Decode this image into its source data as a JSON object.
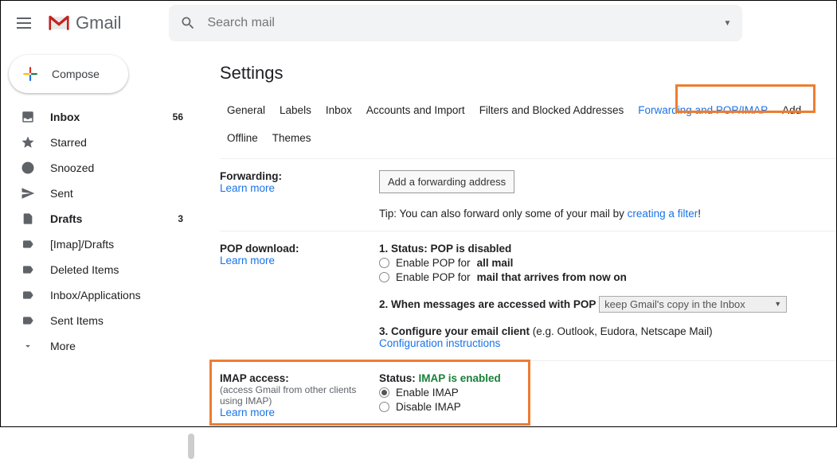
{
  "header": {
    "logo_text": "Gmail",
    "search_placeholder": "Search mail"
  },
  "compose": {
    "label": "Compose"
  },
  "sidebar": {
    "items": [
      {
        "icon": "inbox",
        "label": "Inbox",
        "count": "56",
        "bold": true
      },
      {
        "icon": "star",
        "label": "Starred"
      },
      {
        "icon": "clock",
        "label": "Snoozed"
      },
      {
        "icon": "send",
        "label": "Sent"
      },
      {
        "icon": "file",
        "label": "Drafts",
        "count": "3",
        "bold": true
      },
      {
        "icon": "label",
        "label": "[Imap]/Drafts"
      },
      {
        "icon": "label",
        "label": "Deleted Items"
      },
      {
        "icon": "label",
        "label": "Inbox/Applications"
      },
      {
        "icon": "label",
        "label": "Sent Items"
      },
      {
        "icon": "more",
        "label": "More"
      }
    ]
  },
  "settings": {
    "title": "Settings",
    "tabs": [
      "General",
      "Labels",
      "Inbox",
      "Accounts and Import",
      "Filters and Blocked Addresses",
      "Forwarding and POP/IMAP",
      "Add"
    ],
    "tabs_row2": [
      "Offline",
      "Themes"
    ],
    "active_tab_index": 5,
    "forwarding": {
      "title": "Forwarding:",
      "learn_more": "Learn more",
      "button": "Add a forwarding address",
      "tip_prefix": "Tip: You can also forward only some of your mail by ",
      "tip_link": "creating a filter",
      "tip_suffix": "!"
    },
    "pop": {
      "title": "POP download:",
      "learn_more": "Learn more",
      "status_label": "1. Status: ",
      "status_value": "POP is disabled",
      "opt1_pre": "Enable POP for ",
      "opt1_bold": "all mail",
      "opt2_pre": "Enable POP for ",
      "opt2_bold": "mail that arrives from now on",
      "line2": "2. When messages are accessed with POP",
      "select_value": "keep Gmail's copy in the Inbox",
      "line3_pre": "3. Configure your email client ",
      "line3_paren": "(e.g. Outlook, Eudora, Netscape Mail)",
      "config_link": "Configuration instructions"
    },
    "imap": {
      "title": "IMAP access:",
      "sub": "(access Gmail from other clients using IMAP)",
      "learn_more": "Learn more",
      "status_label": "Status: ",
      "status_value": "IMAP is enabled",
      "opt_enable": "Enable IMAP",
      "opt_disable": "Disable IMAP"
    }
  }
}
